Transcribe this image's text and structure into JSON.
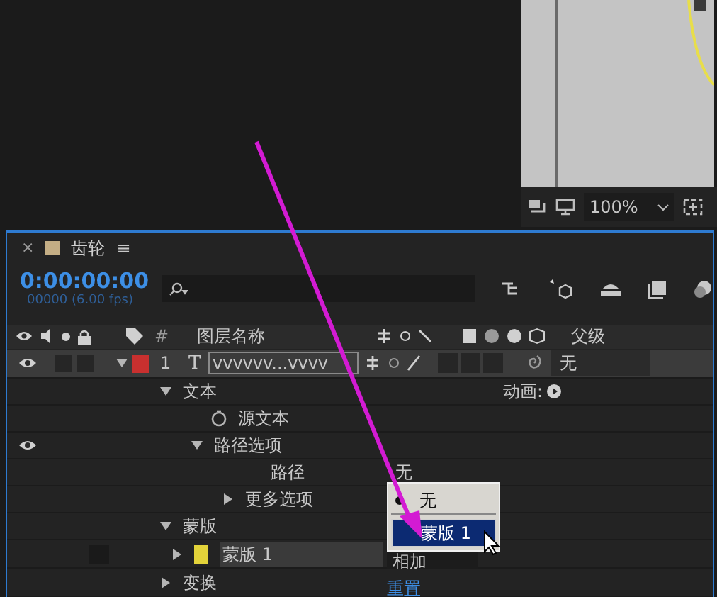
{
  "viewer": {
    "zoom": "100%"
  },
  "timeline": {
    "tab_title": "齿轮",
    "menu_glyph": "≡",
    "close_glyph": "×",
    "timecode": "0:00:00:00",
    "frame_info": "00000 (6.00 fps)",
    "columns": {
      "number": "#",
      "layer_name": "图层名称",
      "parent": "父级"
    },
    "layer": {
      "visible": true,
      "solo": false,
      "locked": false,
      "expanded": true,
      "color": "#c8302f",
      "number": "1",
      "type_glyph": "T",
      "name": "vvvvvv...vvvv",
      "parent": "无"
    },
    "properties": [
      {
        "label": "文本",
        "visible": false,
        "expanded": true,
        "control": {
          "kind": "animate",
          "label": "动画:"
        },
        "children": [
          {
            "label": "源文本",
            "visible": false,
            "kind": "stopwatch"
          },
          {
            "label": "路径选项",
            "visible": true,
            "expanded": true,
            "children": [
              {
                "label": "路径",
                "visible": false,
                "kind": "plain",
                "control": {
                  "kind": "select",
                  "label": "无"
                }
              },
              {
                "label": "更多选项",
                "visible": false,
                "expanded": false
              }
            ]
          }
        ]
      },
      {
        "label": "蒙版",
        "visible": false,
        "expanded": true,
        "children": [
          {
            "label": "蒙版 1",
            "visible": false,
            "expanded": false,
            "color": "#e3d33a",
            "control": {
              "kind": "mode",
              "label": "相加"
            }
          }
        ]
      },
      {
        "label": "变换",
        "visible": false,
        "expanded": false,
        "control": {
          "kind": "link",
          "label": "重置"
        }
      }
    ]
  },
  "dropdown": {
    "items": [
      {
        "label": "无",
        "selected": false,
        "current": true
      },
      {
        "label": "蒙版 1",
        "selected": true,
        "current": false
      }
    ]
  }
}
